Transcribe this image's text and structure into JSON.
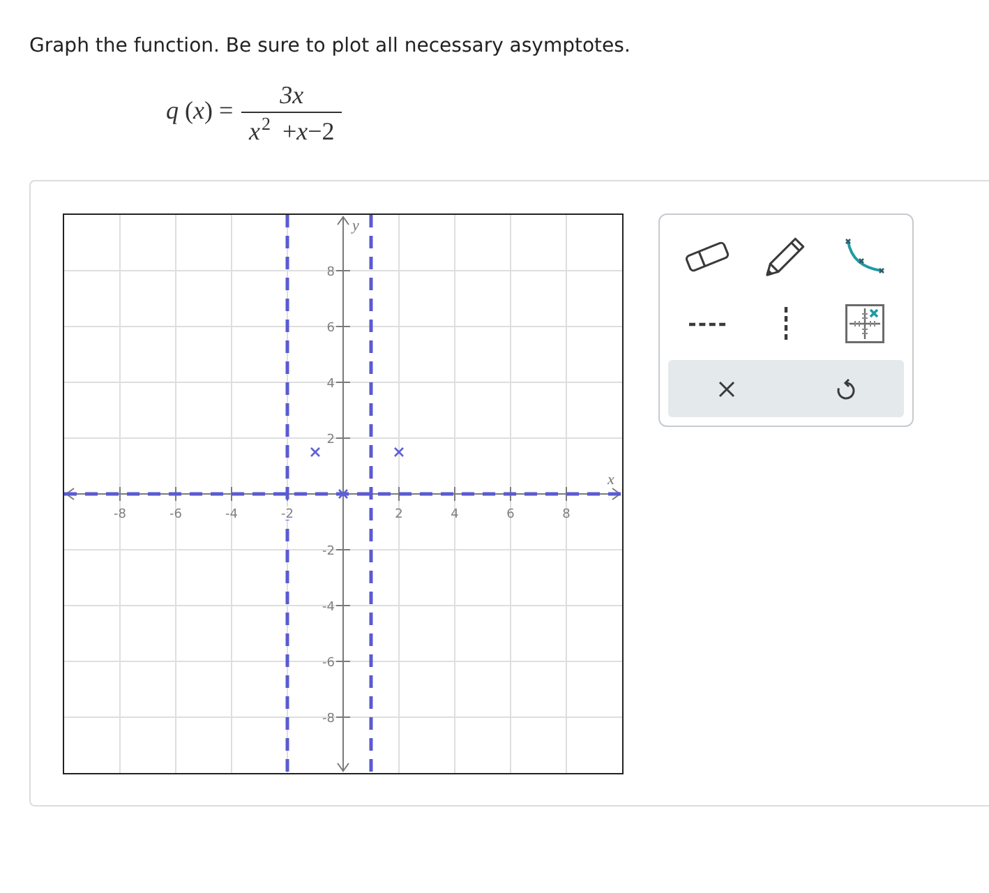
{
  "prompt": "Graph the function. Be sure to plot all necessary asymptotes.",
  "function": {
    "lhs": "*q* (*x*) =",
    "numerator": "3x",
    "denominator": "*x*$^{2}$ +*x*−2"
  },
  "graph": {
    "chart_data": {
      "type": "scatter",
      "xlabel": "x",
      "ylabel": "y",
      "x": [
        -1,
        0,
        2
      ],
      "series": [
        {
          "color": "#5f5fd6",
          "values": [
            1.5,
            0,
            1.5
          ]
        }
      ],
      "xlim": [
        -10,
        10
      ],
      "ylim": [
        -10,
        10
      ],
      "xticks": [
        -8,
        -6,
        -4,
        -2,
        2,
        4,
        6,
        8
      ],
      "yticks": [
        -8,
        -6,
        -4,
        -2,
        2,
        4,
        6,
        8
      ],
      "grid": true,
      "ref_lines": [
        {
          "axis": "x",
          "value": -2
        },
        {
          "axis": "x",
          "value": 1
        },
        {
          "axis": "y",
          "value": 0
        }
      ]
    }
  },
  "toolbar": {
    "tools": [
      {
        "kind": "eraser",
        "selected": false
      },
      {
        "kind": "pencil",
        "selected": false
      },
      {
        "kind": "curve",
        "selected": false
      },
      {
        "kind": "horizontal-asymptote",
        "selected": false
      },
      {
        "kind": "vertical-asymptote",
        "selected": false
      },
      {
        "kind": "point",
        "selected": false
      }
    ],
    "actions": [
      {
        "kind": "clear"
      },
      {
        "kind": "undo"
      }
    ]
  }
}
